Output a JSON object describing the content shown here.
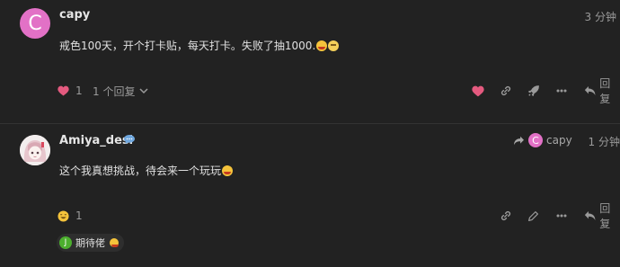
{
  "posts": [
    {
      "avatar_letter": "C",
      "avatar_color": "#e271c6",
      "username": "capy",
      "time": "3 分钟",
      "content": "戒色100天，开个打卡贴，每天打卡。失败了抽1000.",
      "likes": "1",
      "replies_label": "1 个回复",
      "reply_label": "回复"
    },
    {
      "avatar_image": "anime-girl-avatar",
      "username": "Amiya_desi",
      "reply_to_letter": "C",
      "reply_to_user": "capy",
      "time": "1 分钟",
      "content": "这个我真想挑战，待会来一个玩玩",
      "reactions_count": "1",
      "reply_label": "回复",
      "reaction_chip_letter": "J",
      "reaction_chip_text": "期待佬"
    }
  ],
  "colors": {
    "background": "#222222",
    "like_heart": "#e45a7f",
    "avatar_capy": "#e271c6",
    "chip_avatar": "#4caf2e"
  },
  "icons": [
    "heart-icon",
    "chevron-down-icon",
    "link-icon",
    "rocket-icon",
    "more-icon",
    "reply-icon",
    "pencil-icon",
    "smile-icon",
    "chat-bubble-icon",
    "share-arrow-icon"
  ]
}
